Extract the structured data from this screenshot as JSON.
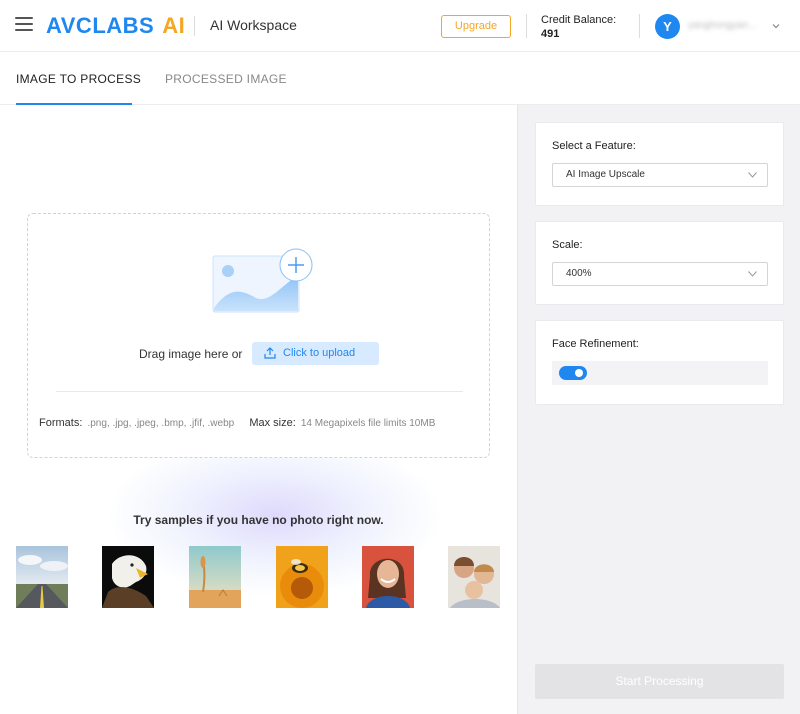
{
  "header": {
    "logo_main": "AVCLABS",
    "logo_accent": "AI",
    "workspace_title": "AI Workspace",
    "upgrade_label": "Upgrade",
    "credit_label": "Credit Balance:",
    "credit_value": "491",
    "avatar_initial": "Y",
    "username": "yanghongyan..."
  },
  "tabs": [
    {
      "label": "IMAGE TO PROCESS",
      "active": true
    },
    {
      "label": "PROCESSED IMAGE",
      "active": false
    }
  ],
  "upload": {
    "drag_text": "Drag image here or",
    "button_label": "Click to upload",
    "formats_label": "Formats:",
    "formats_value": ".png, .jpg, .jpeg, .bmp, .jfif, .webp",
    "maxsize_label": "Max size:",
    "maxsize_value": "14 Megapixels file limits 10MB"
  },
  "samples": {
    "title": "Try samples if you have no photo right now.",
    "items": [
      "road-landscape",
      "eagle",
      "wheat-field",
      "bee-on-flower",
      "smiling-woman",
      "family"
    ]
  },
  "settings": {
    "feature_label": "Select a Feature:",
    "feature_value": "AI Image Upscale",
    "scale_label": "Scale:",
    "scale_value": "400%",
    "face_label": "Face Refinement:",
    "face_enabled": true,
    "start_label": "Start Processing"
  },
  "colors": {
    "brand_blue": "#1e88f0",
    "brand_orange": "#f5a623",
    "panel_bg": "#f2f2f4"
  }
}
